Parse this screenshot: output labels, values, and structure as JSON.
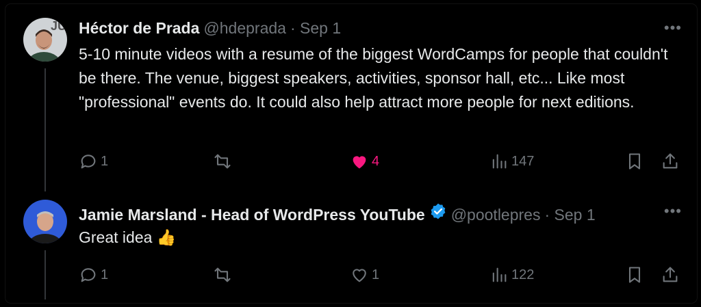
{
  "tweets": [
    {
      "author": "Héctor de Prada",
      "handle": "@hdeprada",
      "time": "· Sep 1",
      "text": "5-10 minute videos with a resume of the biggest WordCamps for people that couldn't be there. The venue, biggest speakers, activities,  sponsor hall, etc... Like most \"professional\" events do. It could also help attract more people for next editions.",
      "replies": "1",
      "retweets": "",
      "likes": "4",
      "views": "147",
      "liked": true
    },
    {
      "author": "Jamie Marsland - Head of WordPress YouTube",
      "handle": "@pootlepres",
      "time": "· Sep 1",
      "text": "Great idea 👍",
      "replies": "1",
      "retweets": "",
      "likes": "1",
      "views": "122",
      "liked": false
    }
  ],
  "more_label": "•••",
  "colors": {
    "like": "#f91880",
    "verified": "#1d9bf0",
    "muted": "#71767b"
  }
}
